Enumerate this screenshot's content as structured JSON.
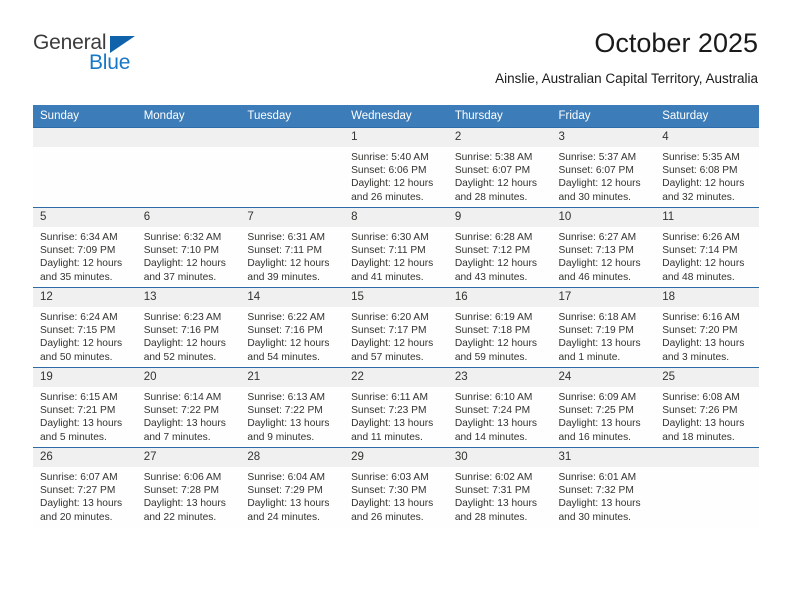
{
  "logo": {
    "word_one": "General",
    "word_two": "Blue",
    "triangle_icon": "triangle-icon"
  },
  "header": {
    "title": "October 2025",
    "location": "Ainslie, Australian Capital Territory, Australia"
  },
  "colors": {
    "header_blue": "#3c7cb8",
    "row_divider_blue": "#2d6ca8",
    "daynum_band": "#f0f0f0",
    "logo_blue": "#1878c8",
    "logo_triangle": "#1063ab",
    "text": "#33332f"
  },
  "weekday_headers": [
    "Sunday",
    "Monday",
    "Tuesday",
    "Wednesday",
    "Thursday",
    "Friday",
    "Saturday"
  ],
  "labels": {
    "sunrise": "Sunrise:",
    "sunset": "Sunset:",
    "daylight": "Daylight:"
  },
  "weeks": [
    [
      {
        "day": "",
        "lines": []
      },
      {
        "day": "",
        "lines": []
      },
      {
        "day": "",
        "lines": []
      },
      {
        "day": "1",
        "lines": [
          "Sunrise: 5:40 AM",
          "Sunset: 6:06 PM",
          "Daylight: 12 hours",
          "and 26 minutes."
        ]
      },
      {
        "day": "2",
        "lines": [
          "Sunrise: 5:38 AM",
          "Sunset: 6:07 PM",
          "Daylight: 12 hours",
          "and 28 minutes."
        ]
      },
      {
        "day": "3",
        "lines": [
          "Sunrise: 5:37 AM",
          "Sunset: 6:07 PM",
          "Daylight: 12 hours",
          "and 30 minutes."
        ]
      },
      {
        "day": "4",
        "lines": [
          "Sunrise: 5:35 AM",
          "Sunset: 6:08 PM",
          "Daylight: 12 hours",
          "and 32 minutes."
        ]
      }
    ],
    [
      {
        "day": "5",
        "lines": [
          "Sunrise: 6:34 AM",
          "Sunset: 7:09 PM",
          "Daylight: 12 hours",
          "and 35 minutes."
        ]
      },
      {
        "day": "6",
        "lines": [
          "Sunrise: 6:32 AM",
          "Sunset: 7:10 PM",
          "Daylight: 12 hours",
          "and 37 minutes."
        ]
      },
      {
        "day": "7",
        "lines": [
          "Sunrise: 6:31 AM",
          "Sunset: 7:11 PM",
          "Daylight: 12 hours",
          "and 39 minutes."
        ]
      },
      {
        "day": "8",
        "lines": [
          "Sunrise: 6:30 AM",
          "Sunset: 7:11 PM",
          "Daylight: 12 hours",
          "and 41 minutes."
        ]
      },
      {
        "day": "9",
        "lines": [
          "Sunrise: 6:28 AM",
          "Sunset: 7:12 PM",
          "Daylight: 12 hours",
          "and 43 minutes."
        ]
      },
      {
        "day": "10",
        "lines": [
          "Sunrise: 6:27 AM",
          "Sunset: 7:13 PM",
          "Daylight: 12 hours",
          "and 46 minutes."
        ]
      },
      {
        "day": "11",
        "lines": [
          "Sunrise: 6:26 AM",
          "Sunset: 7:14 PM",
          "Daylight: 12 hours",
          "and 48 minutes."
        ]
      }
    ],
    [
      {
        "day": "12",
        "lines": [
          "Sunrise: 6:24 AM",
          "Sunset: 7:15 PM",
          "Daylight: 12 hours",
          "and 50 minutes."
        ]
      },
      {
        "day": "13",
        "lines": [
          "Sunrise: 6:23 AM",
          "Sunset: 7:16 PM",
          "Daylight: 12 hours",
          "and 52 minutes."
        ]
      },
      {
        "day": "14",
        "lines": [
          "Sunrise: 6:22 AM",
          "Sunset: 7:16 PM",
          "Daylight: 12 hours",
          "and 54 minutes."
        ]
      },
      {
        "day": "15",
        "lines": [
          "Sunrise: 6:20 AM",
          "Sunset: 7:17 PM",
          "Daylight: 12 hours",
          "and 57 minutes."
        ]
      },
      {
        "day": "16",
        "lines": [
          "Sunrise: 6:19 AM",
          "Sunset: 7:18 PM",
          "Daylight: 12 hours",
          "and 59 minutes."
        ]
      },
      {
        "day": "17",
        "lines": [
          "Sunrise: 6:18 AM",
          "Sunset: 7:19 PM",
          "Daylight: 13 hours",
          "and 1 minute."
        ]
      },
      {
        "day": "18",
        "lines": [
          "Sunrise: 6:16 AM",
          "Sunset: 7:20 PM",
          "Daylight: 13 hours",
          "and 3 minutes."
        ]
      }
    ],
    [
      {
        "day": "19",
        "lines": [
          "Sunrise: 6:15 AM",
          "Sunset: 7:21 PM",
          "Daylight: 13 hours",
          "and 5 minutes."
        ]
      },
      {
        "day": "20",
        "lines": [
          "Sunrise: 6:14 AM",
          "Sunset: 7:22 PM",
          "Daylight: 13 hours",
          "and 7 minutes."
        ]
      },
      {
        "day": "21",
        "lines": [
          "Sunrise: 6:13 AM",
          "Sunset: 7:22 PM",
          "Daylight: 13 hours",
          "and 9 minutes."
        ]
      },
      {
        "day": "22",
        "lines": [
          "Sunrise: 6:11 AM",
          "Sunset: 7:23 PM",
          "Daylight: 13 hours",
          "and 11 minutes."
        ]
      },
      {
        "day": "23",
        "lines": [
          "Sunrise: 6:10 AM",
          "Sunset: 7:24 PM",
          "Daylight: 13 hours",
          "and 14 minutes."
        ]
      },
      {
        "day": "24",
        "lines": [
          "Sunrise: 6:09 AM",
          "Sunset: 7:25 PM",
          "Daylight: 13 hours",
          "and 16 minutes."
        ]
      },
      {
        "day": "25",
        "lines": [
          "Sunrise: 6:08 AM",
          "Sunset: 7:26 PM",
          "Daylight: 13 hours",
          "and 18 minutes."
        ]
      }
    ],
    [
      {
        "day": "26",
        "lines": [
          "Sunrise: 6:07 AM",
          "Sunset: 7:27 PM",
          "Daylight: 13 hours",
          "and 20 minutes."
        ]
      },
      {
        "day": "27",
        "lines": [
          "Sunrise: 6:06 AM",
          "Sunset: 7:28 PM",
          "Daylight: 13 hours",
          "and 22 minutes."
        ]
      },
      {
        "day": "28",
        "lines": [
          "Sunrise: 6:04 AM",
          "Sunset: 7:29 PM",
          "Daylight: 13 hours",
          "and 24 minutes."
        ]
      },
      {
        "day": "29",
        "lines": [
          "Sunrise: 6:03 AM",
          "Sunset: 7:30 PM",
          "Daylight: 13 hours",
          "and 26 minutes."
        ]
      },
      {
        "day": "30",
        "lines": [
          "Sunrise: 6:02 AM",
          "Sunset: 7:31 PM",
          "Daylight: 13 hours",
          "and 28 minutes."
        ]
      },
      {
        "day": "31",
        "lines": [
          "Sunrise: 6:01 AM",
          "Sunset: 7:32 PM",
          "Daylight: 13 hours",
          "and 30 minutes."
        ]
      },
      {
        "day": "",
        "lines": []
      }
    ]
  ]
}
